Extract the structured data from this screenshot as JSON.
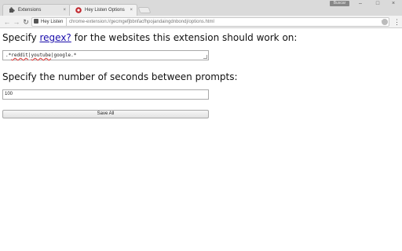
{
  "browser": {
    "tabs": [
      {
        "title": "Extensions",
        "close": "×",
        "icon": "puzzle-icon"
      },
      {
        "title": "Hey Listen Options",
        "close": "×",
        "icon": "hey-listen-icon"
      }
    ],
    "profile_badge": "Buscar",
    "window_controls": {
      "minimize": "–",
      "maximize": "□",
      "close": "×"
    }
  },
  "toolbar": {
    "back": "←",
    "forward": "→",
    "reload": "↻",
    "origin_label": "Hey Listen",
    "url": "chrome-extension://gecmgefjbbnfacfhpojandaingdnbondj/options.html",
    "star": "☆",
    "menu": "⋮"
  },
  "page": {
    "regex_heading_pre": "Specify ",
    "regex_link": "regex?",
    "regex_heading_post": " for the websites this extension should work on:",
    "regex_value_parts": [
      ".*",
      "reddit",
      "|",
      "youtube",
      "|google.*"
    ],
    "seconds_heading": "Specify the number of seconds between prompts:",
    "seconds_value": "100",
    "save_label": "Save All"
  },
  "colors": {
    "link": "#1a0dab",
    "tabstrip": "#dadada",
    "toolbar": "#f2f2f2",
    "spellcheck_underline": "#d33"
  }
}
